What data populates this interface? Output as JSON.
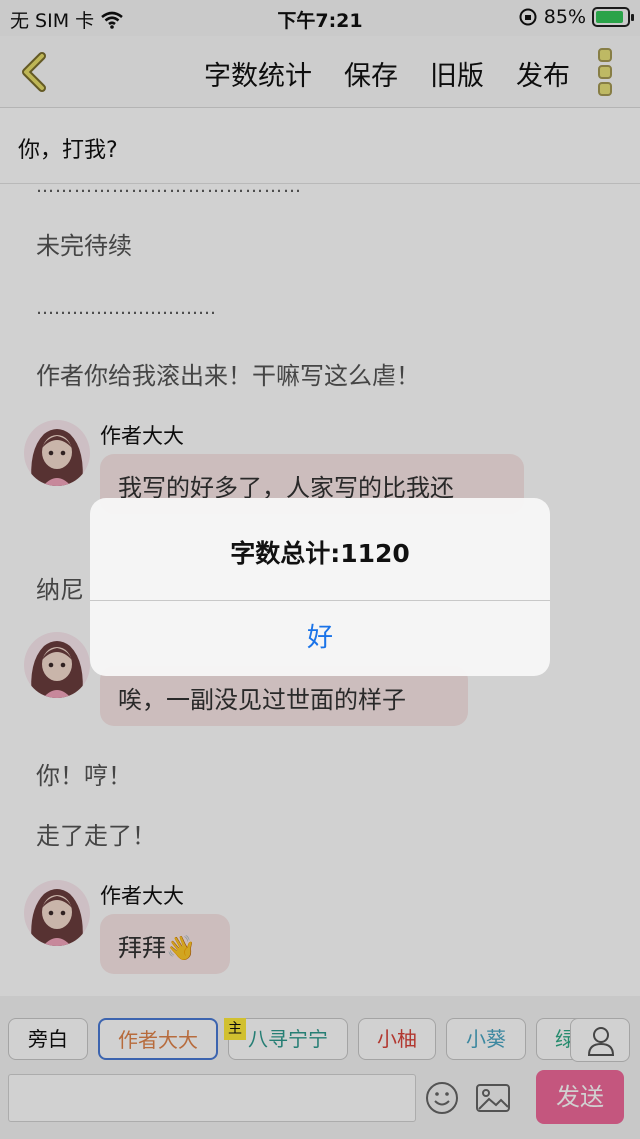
{
  "status": {
    "carrier": "无 SIM 卡",
    "time": "下午7:21",
    "battery": "85%"
  },
  "nav": {
    "actions": [
      "字数统计",
      "保存",
      "旧版",
      "发布"
    ]
  },
  "story_title": "你，打我?",
  "content": {
    "dots_1": "……………………………………",
    "line_1": "未完待续",
    "dots_2": "…………………………",
    "line_2": "作者你给我滚出来！干嘛写这么虐！",
    "speaker_1": "作者大大",
    "bubble_1": "我写的好多了，人家写的比我还",
    "line_3": "纳尼",
    "bubble_2": "唉，一副没见过世面的样子",
    "line_4": "你！哼！",
    "line_5": "走了走了！",
    "speaker_3": "作者大大",
    "bubble_3": "拜拜👋"
  },
  "characters": {
    "items": [
      "旁白",
      "作者大大",
      "八寻宁宁",
      "小柚",
      "小葵",
      "绿"
    ],
    "host_badge": "主"
  },
  "composer": {
    "send_label": "发送"
  },
  "alert": {
    "title": "字数总计:1120",
    "button": "好"
  },
  "colors": {
    "accent_pink": "#f06a9a",
    "alert_button_blue": "#1a73e8",
    "bubble_bg": "#f9e7e7"
  }
}
